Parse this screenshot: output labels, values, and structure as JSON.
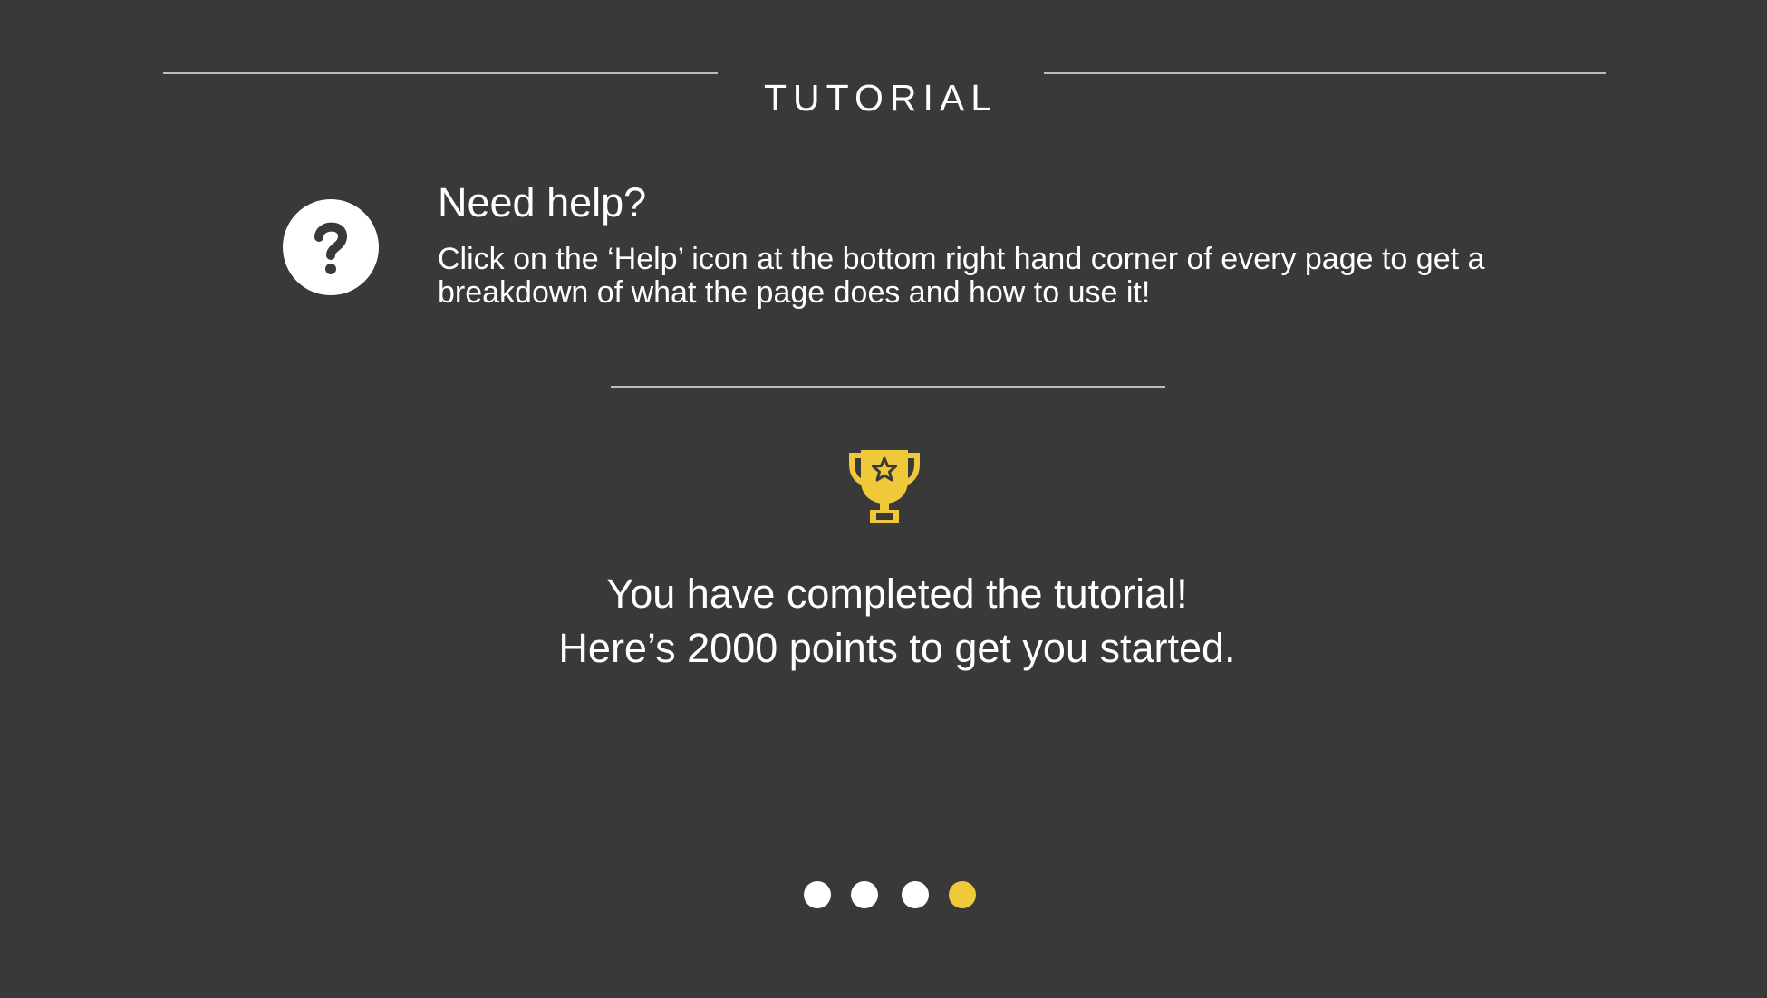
{
  "header": {
    "title": "TUTORIAL"
  },
  "help": {
    "icon": "question-circle-icon",
    "heading": "Need help?",
    "text": "Click on the ‘Help’ icon at the bottom right hand corner of every page to get a breakdown of what the page does and how to use it!"
  },
  "completion": {
    "icon": "trophy-icon",
    "line1": "You have completed the tutorial!",
    "line2": "Here’s 2000 points to get you started."
  },
  "pagination": {
    "total_pages": 4,
    "current_page": 4
  },
  "colors": {
    "background": "#393939",
    "accent": "#f0c93a",
    "text": "#ffffff"
  }
}
